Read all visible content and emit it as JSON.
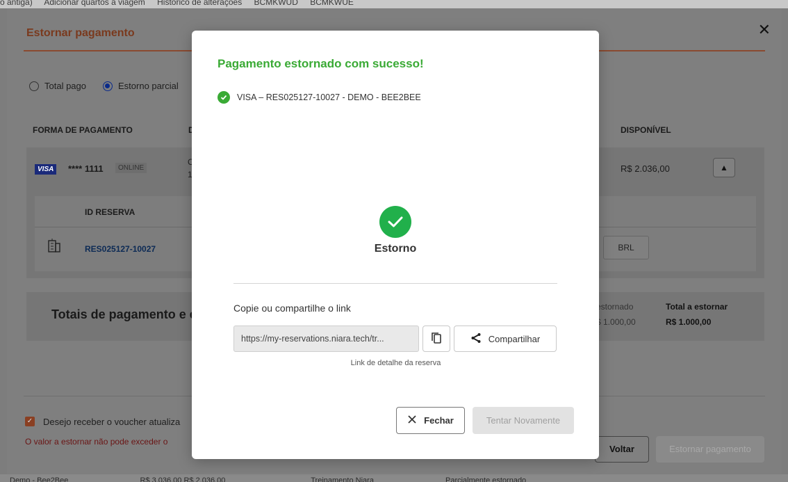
{
  "background": {
    "top_strip": [
      "o antiga)",
      "Adicionar quartos à viagem",
      "Histórico de alterações",
      "BCMKWUD",
      "BCMKWUE"
    ],
    "bottom_strip": [
      "Demo - Bee2Bee",
      "R$ 3.036,00  R$ 2.036,00",
      "Treinamento Niara",
      "Parcialmente estornado"
    ]
  },
  "refund_dialog": {
    "title": "Estornar pagamento",
    "close_glyph": "✕",
    "radio_total": "Total pago",
    "radio_partial": "Estorno parcial",
    "col_payment": "FORMA DE PAGAMENTO",
    "col_d": "D",
    "col_available": "DISPONÍVEL",
    "card_brand": "VISA",
    "card_number": "**** 1111",
    "card_badge": "ONLINE",
    "card_frag_1": "C",
    "card_frag_2": "1",
    "available_value": "R$ 2.036,00",
    "chevron_up": "▲",
    "col_reservation_id": "ID RESERVA",
    "reservation_id": "RES025127-10027",
    "currency": "BRL",
    "totals_title": "Totais de pagamento e e",
    "refunded_label": "estornado",
    "refunded_value": "$ 1.000,00",
    "to_refund_label": "Total a estornar",
    "to_refund_value": "R$ 1.000,00",
    "voucher_checkbox_label": "Desejo receber o voucher atualiza",
    "error_message": "O valor a estornar não pode exceder o",
    "back_button": "Voltar",
    "submit_button": "Estornar pagamento"
  },
  "success_modal": {
    "title": "Pagamento estornado com sucesso!",
    "item": "VISA – RES025127-10027 - DEMO - BEE2BEE",
    "status_label": "Estorno",
    "copy_label": "Copie ou compartilhe o link",
    "link_value": "https://my-reservations.niara.tech/tr...",
    "share_button": "Compartilhar",
    "link_hint": "Link de detalhe da reserva",
    "close_button": "Fechar",
    "retry_button": "Tentar Novamente"
  },
  "colors": {
    "success_green": "#3aaa35",
    "check_green": "#21b04b",
    "accent_orange": "#e8692f",
    "overlay": "#7d7d7d"
  }
}
